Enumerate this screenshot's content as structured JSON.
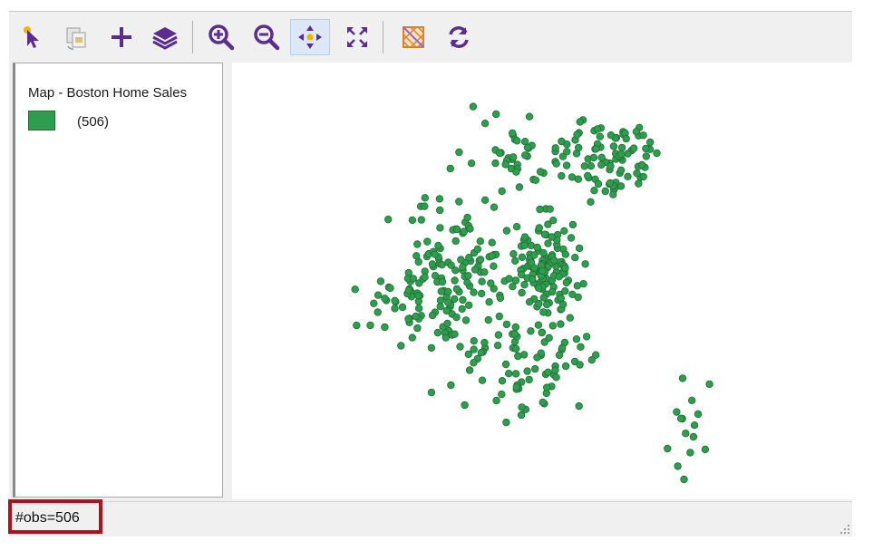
{
  "toolbar": {
    "buttons": [
      {
        "icon": "select-arrow-icon"
      },
      {
        "icon": "copy-layer-icon"
      },
      {
        "icon": "add-icon"
      },
      {
        "icon": "layers-icon"
      },
      {
        "icon": "zoom-in-icon"
      },
      {
        "icon": "zoom-out-icon"
      },
      {
        "icon": "pan-icon",
        "active": true
      },
      {
        "icon": "full-extent-icon"
      },
      {
        "icon": "basemap-icon"
      },
      {
        "icon": "refresh-icon"
      }
    ],
    "icon_color": "#5a2d91"
  },
  "legend": {
    "title": "Map - Boston Home Sales",
    "count_label": "(506)",
    "swatch_color": "#2e9e4e"
  },
  "map": {
    "point_color": "#2e9e4e",
    "point_stroke": "#1f6e35",
    "observation_count": 506
  },
  "status": {
    "obs_label": "#obs=506",
    "highlight_color": "#b0121a"
  }
}
